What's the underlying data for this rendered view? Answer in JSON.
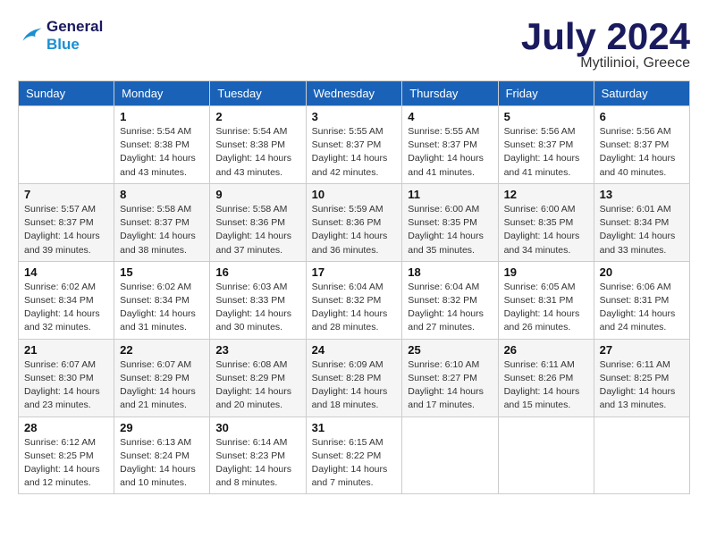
{
  "logo": {
    "line1": "General",
    "line2": "Blue"
  },
  "title": "July 2024",
  "location": "Mytilinioi, Greece",
  "headers": [
    "Sunday",
    "Monday",
    "Tuesday",
    "Wednesday",
    "Thursday",
    "Friday",
    "Saturday"
  ],
  "weeks": [
    [
      {
        "day": "",
        "sunrise": "",
        "sunset": "",
        "daylight": ""
      },
      {
        "day": "1",
        "sunrise": "Sunrise: 5:54 AM",
        "sunset": "Sunset: 8:38 PM",
        "daylight": "Daylight: 14 hours and 43 minutes."
      },
      {
        "day": "2",
        "sunrise": "Sunrise: 5:54 AM",
        "sunset": "Sunset: 8:38 PM",
        "daylight": "Daylight: 14 hours and 43 minutes."
      },
      {
        "day": "3",
        "sunrise": "Sunrise: 5:55 AM",
        "sunset": "Sunset: 8:37 PM",
        "daylight": "Daylight: 14 hours and 42 minutes."
      },
      {
        "day": "4",
        "sunrise": "Sunrise: 5:55 AM",
        "sunset": "Sunset: 8:37 PM",
        "daylight": "Daylight: 14 hours and 41 minutes."
      },
      {
        "day": "5",
        "sunrise": "Sunrise: 5:56 AM",
        "sunset": "Sunset: 8:37 PM",
        "daylight": "Daylight: 14 hours and 41 minutes."
      },
      {
        "day": "6",
        "sunrise": "Sunrise: 5:56 AM",
        "sunset": "Sunset: 8:37 PM",
        "daylight": "Daylight: 14 hours and 40 minutes."
      }
    ],
    [
      {
        "day": "7",
        "sunrise": "Sunrise: 5:57 AM",
        "sunset": "Sunset: 8:37 PM",
        "daylight": "Daylight: 14 hours and 39 minutes."
      },
      {
        "day": "8",
        "sunrise": "Sunrise: 5:58 AM",
        "sunset": "Sunset: 8:37 PM",
        "daylight": "Daylight: 14 hours and 38 minutes."
      },
      {
        "day": "9",
        "sunrise": "Sunrise: 5:58 AM",
        "sunset": "Sunset: 8:36 PM",
        "daylight": "Daylight: 14 hours and 37 minutes."
      },
      {
        "day": "10",
        "sunrise": "Sunrise: 5:59 AM",
        "sunset": "Sunset: 8:36 PM",
        "daylight": "Daylight: 14 hours and 36 minutes."
      },
      {
        "day": "11",
        "sunrise": "Sunrise: 6:00 AM",
        "sunset": "Sunset: 8:35 PM",
        "daylight": "Daylight: 14 hours and 35 minutes."
      },
      {
        "day": "12",
        "sunrise": "Sunrise: 6:00 AM",
        "sunset": "Sunset: 8:35 PM",
        "daylight": "Daylight: 14 hours and 34 minutes."
      },
      {
        "day": "13",
        "sunrise": "Sunrise: 6:01 AM",
        "sunset": "Sunset: 8:34 PM",
        "daylight": "Daylight: 14 hours and 33 minutes."
      }
    ],
    [
      {
        "day": "14",
        "sunrise": "Sunrise: 6:02 AM",
        "sunset": "Sunset: 8:34 PM",
        "daylight": "Daylight: 14 hours and 32 minutes."
      },
      {
        "day": "15",
        "sunrise": "Sunrise: 6:02 AM",
        "sunset": "Sunset: 8:34 PM",
        "daylight": "Daylight: 14 hours and 31 minutes."
      },
      {
        "day": "16",
        "sunrise": "Sunrise: 6:03 AM",
        "sunset": "Sunset: 8:33 PM",
        "daylight": "Daylight: 14 hours and 30 minutes."
      },
      {
        "day": "17",
        "sunrise": "Sunrise: 6:04 AM",
        "sunset": "Sunset: 8:32 PM",
        "daylight": "Daylight: 14 hours and 28 minutes."
      },
      {
        "day": "18",
        "sunrise": "Sunrise: 6:04 AM",
        "sunset": "Sunset: 8:32 PM",
        "daylight": "Daylight: 14 hours and 27 minutes."
      },
      {
        "day": "19",
        "sunrise": "Sunrise: 6:05 AM",
        "sunset": "Sunset: 8:31 PM",
        "daylight": "Daylight: 14 hours and 26 minutes."
      },
      {
        "day": "20",
        "sunrise": "Sunrise: 6:06 AM",
        "sunset": "Sunset: 8:31 PM",
        "daylight": "Daylight: 14 hours and 24 minutes."
      }
    ],
    [
      {
        "day": "21",
        "sunrise": "Sunrise: 6:07 AM",
        "sunset": "Sunset: 8:30 PM",
        "daylight": "Daylight: 14 hours and 23 minutes."
      },
      {
        "day": "22",
        "sunrise": "Sunrise: 6:07 AM",
        "sunset": "Sunset: 8:29 PM",
        "daylight": "Daylight: 14 hours and 21 minutes."
      },
      {
        "day": "23",
        "sunrise": "Sunrise: 6:08 AM",
        "sunset": "Sunset: 8:29 PM",
        "daylight": "Daylight: 14 hours and 20 minutes."
      },
      {
        "day": "24",
        "sunrise": "Sunrise: 6:09 AM",
        "sunset": "Sunset: 8:28 PM",
        "daylight": "Daylight: 14 hours and 18 minutes."
      },
      {
        "day": "25",
        "sunrise": "Sunrise: 6:10 AM",
        "sunset": "Sunset: 8:27 PM",
        "daylight": "Daylight: 14 hours and 17 minutes."
      },
      {
        "day": "26",
        "sunrise": "Sunrise: 6:11 AM",
        "sunset": "Sunset: 8:26 PM",
        "daylight": "Daylight: 14 hours and 15 minutes."
      },
      {
        "day": "27",
        "sunrise": "Sunrise: 6:11 AM",
        "sunset": "Sunset: 8:25 PM",
        "daylight": "Daylight: 14 hours and 13 minutes."
      }
    ],
    [
      {
        "day": "28",
        "sunrise": "Sunrise: 6:12 AM",
        "sunset": "Sunset: 8:25 PM",
        "daylight": "Daylight: 14 hours and 12 minutes."
      },
      {
        "day": "29",
        "sunrise": "Sunrise: 6:13 AM",
        "sunset": "Sunset: 8:24 PM",
        "daylight": "Daylight: 14 hours and 10 minutes."
      },
      {
        "day": "30",
        "sunrise": "Sunrise: 6:14 AM",
        "sunset": "Sunset: 8:23 PM",
        "daylight": "Daylight: 14 hours and 8 minutes."
      },
      {
        "day": "31",
        "sunrise": "Sunrise: 6:15 AM",
        "sunset": "Sunset: 8:22 PM",
        "daylight": "Daylight: 14 hours and 7 minutes."
      },
      {
        "day": "",
        "sunrise": "",
        "sunset": "",
        "daylight": ""
      },
      {
        "day": "",
        "sunrise": "",
        "sunset": "",
        "daylight": ""
      },
      {
        "day": "",
        "sunrise": "",
        "sunset": "",
        "daylight": ""
      }
    ]
  ]
}
